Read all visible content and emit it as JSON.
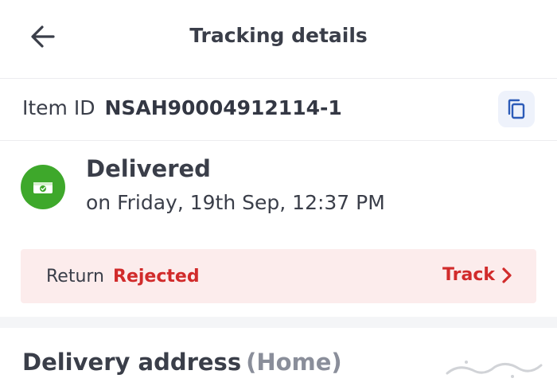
{
  "header": {
    "title": "Tracking details",
    "back_icon": "arrow-left-icon"
  },
  "item": {
    "label": "Item ID",
    "value": "NSAH90004912114-1",
    "copy_icon": "copy-icon"
  },
  "status": {
    "icon": "delivered-box-icon",
    "title": "Delivered",
    "date": "on Friday, 19th Sep, 12:37 PM",
    "color": "#3ea82b"
  },
  "return": {
    "label": "Return",
    "status": "Rejected",
    "track_label": "Track",
    "track_icon": "chevron-right-icon",
    "accent": "#d12b2b",
    "background": "#fcecec"
  },
  "address": {
    "heading": "Delivery address",
    "tag": "(Home)"
  }
}
